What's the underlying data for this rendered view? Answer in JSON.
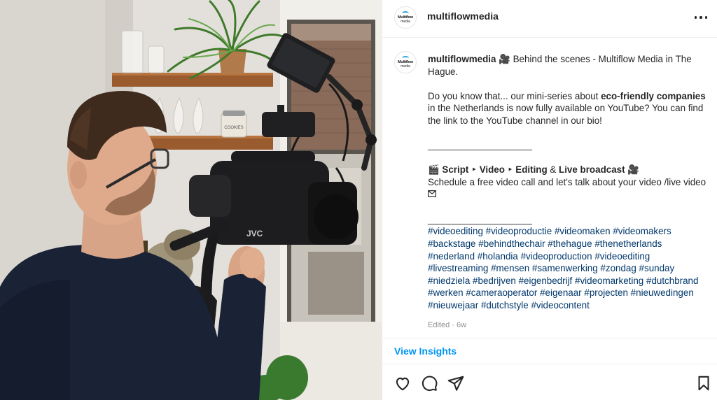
{
  "account": {
    "username": "multiflowmedia",
    "avatar_text_line1": "Multiflow",
    "avatar_text_line2": "media"
  },
  "post": {
    "caption_line1": "🎥 Behind the scenes - Multiflow Media in The Hague.",
    "para2_before": "Do you know that... our mini-series about ",
    "para2_bold": "eco-friendly companies",
    "para2_after": " in the Netherlands is now fully available on YouTube? You can find the link to the YouTube channel in our bio!",
    "divider": "____________________",
    "services_clapper": "🎬",
    "services_script": "Script",
    "services_arrow1": " ‣ ",
    "services_video": "Video",
    "services_arrow2": " ‣ ",
    "services_editing": "Editing",
    "services_amp": " & ",
    "services_live": "Live broadcast",
    "services_end": " 🎥",
    "schedule_text": "Schedule a free video call and let's talk about your video /live video",
    "divider2": "____________________",
    "hashtags": [
      "#videoediting",
      "#videoproductie",
      "#videomaken",
      "#videomakers",
      "#backstage",
      "#behindthechair",
      "#thehague",
      "#thenetherlands",
      "#nederland",
      "#holandia",
      "#videoproduction",
      "#videoediting",
      "#livestreaming",
      "#mensen",
      "#samenwerking",
      "#zondag",
      "#sunday",
      "#niedziela",
      "#bedrijven",
      "#eigenbedrijf",
      "#videomarketing",
      "#dutchbrand",
      "#werken",
      "#cameraoperator",
      "#eigenaar",
      "#projecten",
      "#nieuwedingen",
      "#nieuwejaar",
      "#dutchstyle",
      "#videocontent"
    ],
    "edited_label": "Edited · 6w"
  },
  "insights_label": "View Insights",
  "icons": {
    "more": "more-options-icon",
    "like": "heart-icon",
    "comment": "comment-icon",
    "share": "share-icon",
    "save": "bookmark-icon",
    "mail": "envelope-icon"
  },
  "photo": {
    "camera_brand_text": "JVC",
    "jar_label": "COOKIES"
  },
  "colors": {
    "link": "#00376b",
    "accent": "#0095f6",
    "muted": "#8e8e8e",
    "text": "#262626"
  }
}
